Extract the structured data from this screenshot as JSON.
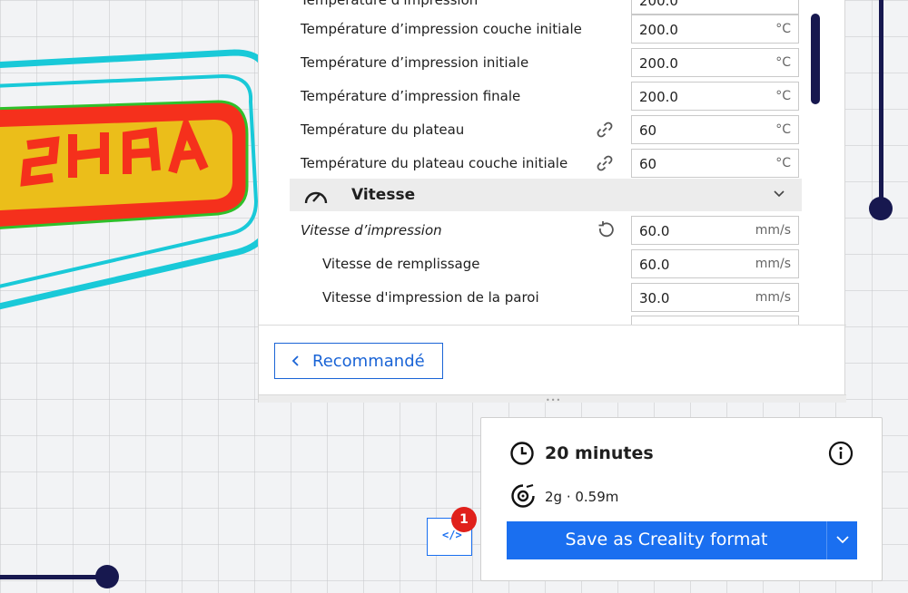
{
  "settings": {
    "partial_row_label": "Température d'impression",
    "partial_row_value": "200.0",
    "rows": [
      {
        "label": "Température d’impression couche initiale",
        "value": "200.0",
        "unit": "°C"
      },
      {
        "label": "Température d’impression initiale",
        "value": "200.0",
        "unit": "°C"
      },
      {
        "label": "Température d’impression finale",
        "value": "200.0",
        "unit": "°C"
      },
      {
        "label": "Température du plateau",
        "value": "60",
        "unit": "°C",
        "icon": "link-icon"
      },
      {
        "label": "Température du plateau couche initiale",
        "value": "60",
        "unit": "°C",
        "icon": "link-icon"
      }
    ],
    "section": {
      "title": "Vitesse",
      "icon": "gauge-icon"
    },
    "speed_rows": [
      {
        "label": "Vitesse d’impression",
        "value": "60.0",
        "unit": "mm/s",
        "icon": "reset-icon"
      },
      {
        "label": "Vitesse de remplissage",
        "value": "60.0",
        "unit": "mm/s"
      },
      {
        "label": "Vitesse d'impression de la paroi",
        "value": "30.0",
        "unit": "mm/s"
      }
    ],
    "recommend_label": "Recommandé"
  },
  "print_info": {
    "time": "20 minutes",
    "material": "2g · 0.59m",
    "save_label": "Save as Creality format"
  },
  "code_button": {
    "glyph": "</>",
    "badge": "1"
  },
  "colors": {
    "accent": "#1a6ff0",
    "navy": "#17184f",
    "model_red": "#f5301c",
    "model_yellow": "#e8e21a",
    "model_green": "#2fc02a",
    "skirt_cyan": "#19c9d8",
    "badge_red": "#e0201b"
  }
}
